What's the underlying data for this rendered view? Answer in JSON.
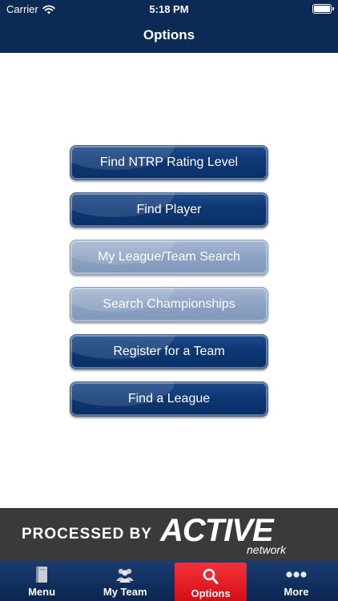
{
  "status_bar": {
    "carrier": "Carrier",
    "time": "5:18 PM"
  },
  "header": {
    "title": "Options"
  },
  "options": [
    {
      "label": "Find NTRP Rating Level",
      "enabled": true
    },
    {
      "label": "Find Player",
      "enabled": true
    },
    {
      "label": "My League/Team Search",
      "enabled": false
    },
    {
      "label": "Search Championships",
      "enabled": false
    },
    {
      "label": "Register for a Team",
      "enabled": true
    },
    {
      "label": "Find a League",
      "enabled": true
    }
  ],
  "banner": {
    "processed_by": "PROCESSED BY",
    "brand": "ACTIVE",
    "brand_sub": "network"
  },
  "tabbar": {
    "tabs": [
      {
        "label": "Menu",
        "icon": "book-icon"
      },
      {
        "label": "My Team",
        "icon": "team-icon"
      },
      {
        "label": "Options",
        "icon": "search-icon",
        "selected": true
      },
      {
        "label": "More",
        "icon": "more-icon"
      }
    ]
  },
  "colors": {
    "header_bg": "#0c2a55",
    "button_active": "#0e3874",
    "button_disabled": "#8da3c3",
    "tab_selected": "#e01b24",
    "banner_bg": "#3a3a3a"
  }
}
